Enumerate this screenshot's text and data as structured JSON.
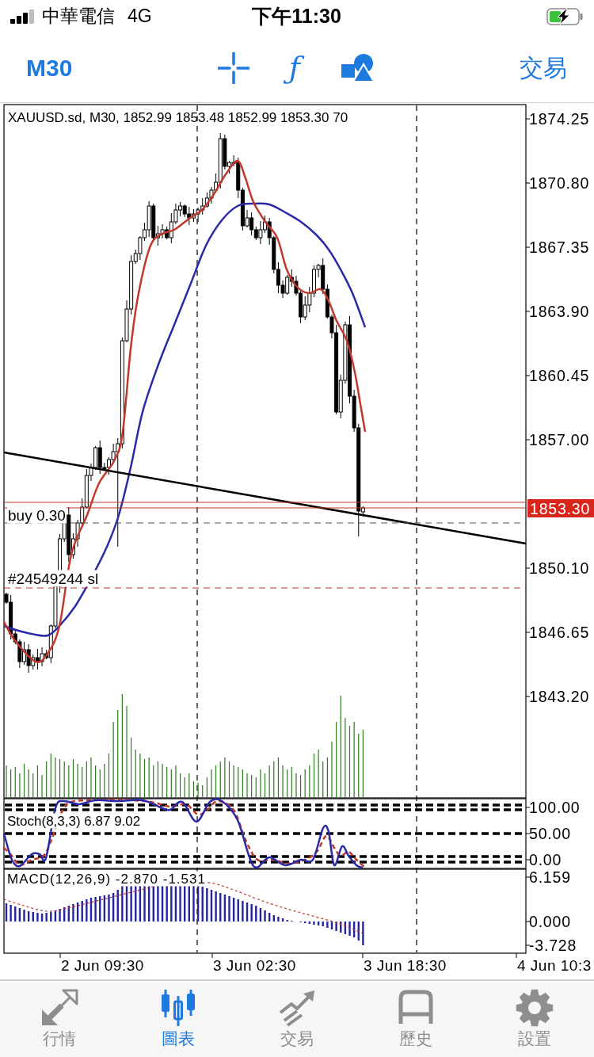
{
  "status_bar": {
    "carrier": "中華電信",
    "network": "4G",
    "time": "下午11:30",
    "charging": true
  },
  "toolbar": {
    "timeframe": "M30",
    "function_symbol": "ƒ",
    "trade": "交易"
  },
  "chart": {
    "header": "XAUUSD.sd, M30, 1852.99 1853.48 1852.99 1853.30 70",
    "price_labels": [
      "1874.25",
      "1870.80",
      "1867.35",
      "1863.90",
      "1860.45",
      "1857.00",
      "1850.10",
      "1846.65",
      "1843.20"
    ],
    "current_price": "1853.30",
    "order_lines": [
      {
        "kind": "entry",
        "label": "buy 0.30"
      },
      {
        "kind": "stop_loss",
        "label": "#24549244 sl"
      }
    ]
  },
  "stochastic": {
    "label": "Stoch(8,3,3) 6.87 9.02",
    "axis_labels": [
      "100.00",
      "50.00",
      "0.00"
    ]
  },
  "macd": {
    "label": "MACD(12,26,9) -2.870 -1.531",
    "axis_labels": [
      "6.159",
      "0.000",
      "-3.728"
    ]
  },
  "time_axis": {
    "labels": [
      "2 Jun 09:30",
      "3 Jun 02:30",
      "3 Jun 18:30",
      "4 Jun 10:3"
    ]
  },
  "tab_bar": [
    {
      "kind": "quotes",
      "label": "行情",
      "selected": false
    },
    {
      "kind": "chart",
      "label": "圖表",
      "selected": true
    },
    {
      "kind": "trade",
      "label": "交易",
      "selected": false
    },
    {
      "kind": "history",
      "label": "歷史",
      "selected": false
    },
    {
      "kind": "settings",
      "label": "設置",
      "selected": false
    }
  ]
}
